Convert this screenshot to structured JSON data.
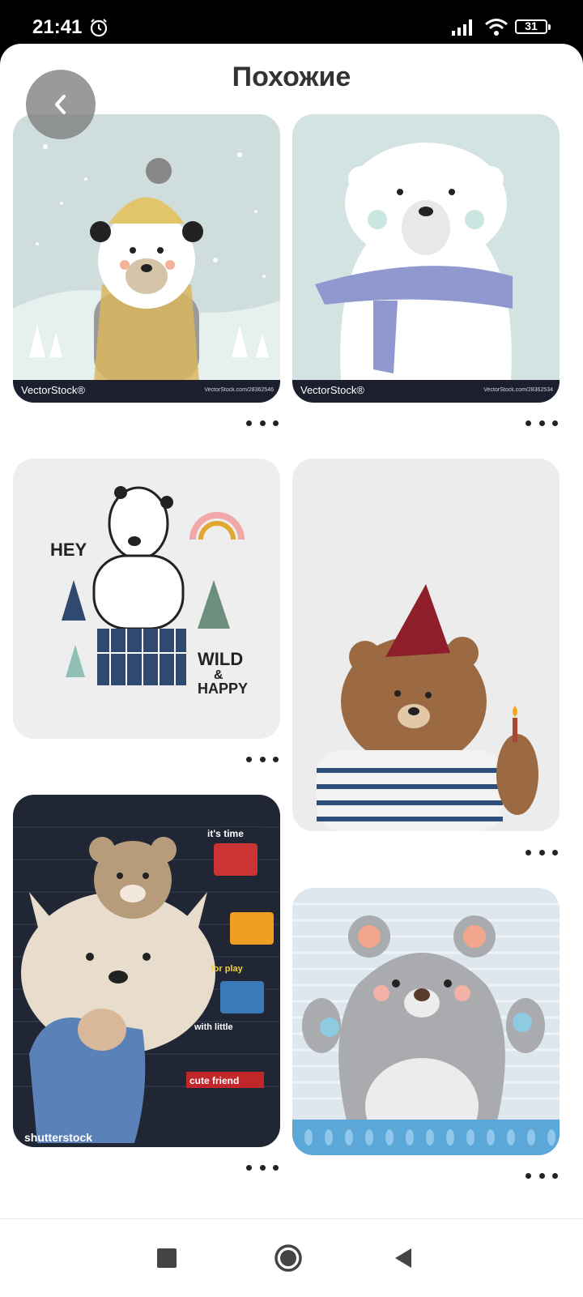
{
  "status_bar": {
    "time": "21:41",
    "battery": "31"
  },
  "header": {
    "title": "Похожие"
  },
  "pins": [
    {
      "watermark_left": "VectorStock®",
      "watermark_right": "VectorStock.com/28362546"
    },
    {
      "watermark_left": "VectorStock®",
      "watermark_right": "VectorStock.com/28362534"
    },
    {
      "text_hey": "HEY",
      "text_wild": "WILD",
      "text_amp": "&",
      "text_happy": "HAPPY"
    },
    {},
    {
      "watermark_left": "shutterstock",
      "text_time": "it's time",
      "text_play": "for play",
      "text_little": "with little",
      "text_friend": "cute friend"
    },
    {}
  ],
  "navigation": {
    "recents": "square-icon",
    "home": "circle-icon",
    "back": "triangle-icon"
  }
}
